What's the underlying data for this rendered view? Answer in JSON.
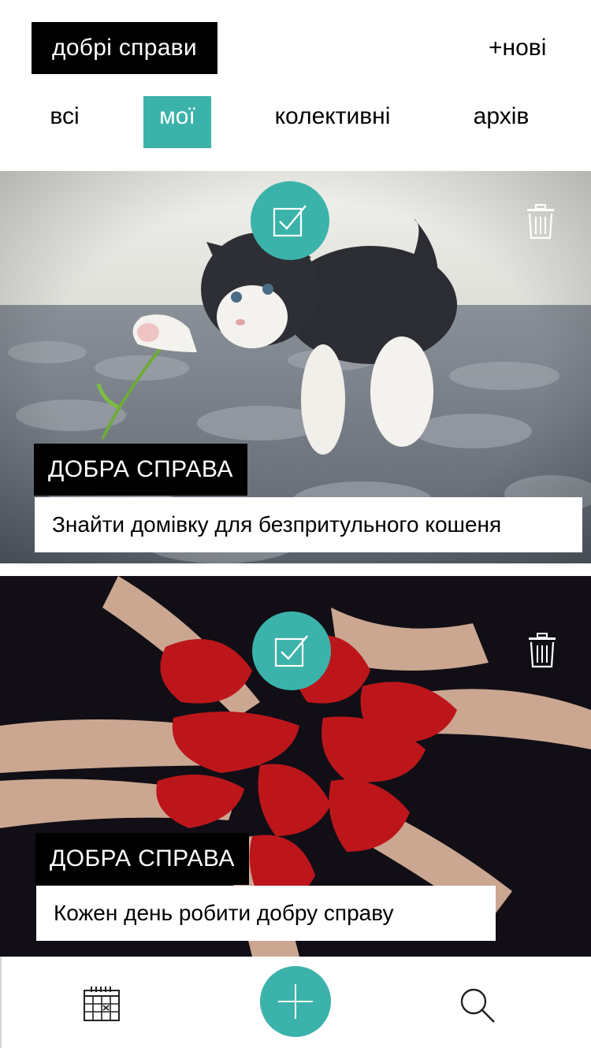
{
  "header": {
    "title": "добрі справи",
    "new_label": "+нові"
  },
  "tabs": [
    {
      "label": "всі",
      "active": false
    },
    {
      "label": "мої",
      "active": true
    },
    {
      "label": "колективні",
      "active": false
    },
    {
      "label": "архів",
      "active": false
    }
  ],
  "cards": [
    {
      "category": "ДОБРА СПРАВА",
      "title": "Знайти домівку для безпритульного кошеня",
      "image": "kitten-with-flower-photo",
      "done_icon": "check-icon",
      "delete_icon": "trash-icon"
    },
    {
      "category": "ДОБРА СПРАВА",
      "title": "Кожен день робити добру справу",
      "image": "red-painted-hands-heart-photo",
      "done_icon": "check-icon",
      "delete_icon": "trash-icon"
    }
  ],
  "bottom_nav": {
    "calendar_icon": "calendar-icon",
    "add_icon": "plus-icon",
    "search_icon": "search-icon"
  },
  "colors": {
    "accent": "#3bb3aa",
    "label_bg": "#000000",
    "text": "#000000"
  }
}
